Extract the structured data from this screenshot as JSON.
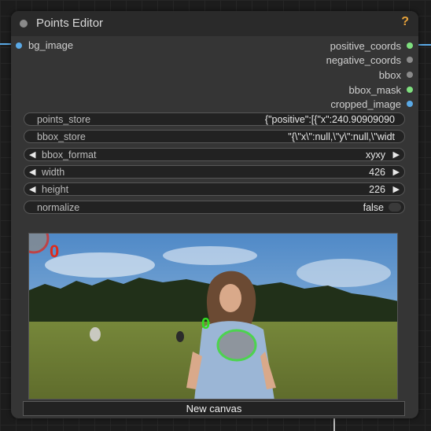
{
  "node": {
    "title": "Points Editor",
    "help": "?"
  },
  "inputs": [
    {
      "label": "bg_image",
      "color": "#5aa9e6"
    }
  ],
  "outputs": [
    {
      "label": "positive_coords",
      "color": "#7fe07f"
    },
    {
      "label": "negative_coords",
      "color": "#8a8a8a"
    },
    {
      "label": "bbox",
      "color": "#8a8a8a"
    },
    {
      "label": "bbox_mask",
      "color": "#7fe07f"
    },
    {
      "label": "cropped_image",
      "color": "#5aa9e6"
    }
  ],
  "widgets": {
    "points_store": {
      "label": "points_store",
      "value": "{\"positive\":[{\"x\":240.90909090"
    },
    "bbox_store": {
      "label": "bbox_store",
      "value": "\"{\\\"x\\\":null,\\\"y\\\":null,\\\"widt"
    },
    "bbox_format": {
      "label": "bbox_format",
      "value": "xyxy"
    },
    "width": {
      "label": "width",
      "value": "426"
    },
    "height": {
      "label": "height",
      "value": "226"
    },
    "normalize": {
      "label": "normalize",
      "value": "false"
    }
  },
  "canvas": {
    "negative_point_label": "0",
    "positive_point_label": "0",
    "negative_color": "#e02a1a",
    "positive_color": "#33dd22"
  },
  "buttons": {
    "new_canvas": "New canvas"
  }
}
